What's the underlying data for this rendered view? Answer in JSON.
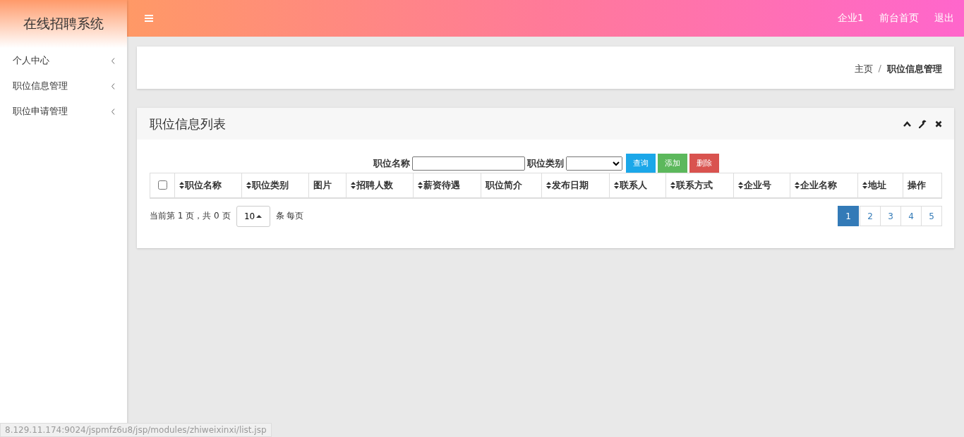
{
  "sidebar": {
    "title": "在线招聘系统",
    "items": [
      {
        "label": "个人中心",
        "expanded": false
      },
      {
        "label": "职位信息管理",
        "expanded": false
      },
      {
        "label": "职位申请管理",
        "expanded": false
      }
    ]
  },
  "topbar": {
    "links": [
      "企业1",
      "前台首页",
      "退出"
    ]
  },
  "breadcrumb": {
    "items": [
      "主页",
      "职位信息管理"
    ],
    "separator": "/"
  },
  "panel": {
    "title": "职位信息列表",
    "search": {
      "name_label": "职位名称",
      "type_label": "职位类别",
      "buttons": [
        {
          "label": "查询",
          "kind": "query"
        },
        {
          "label": "添加",
          "kind": "add"
        },
        {
          "label": "删除",
          "kind": "delete"
        }
      ]
    },
    "table": {
      "select_all_checked": false,
      "columns": [
        {
          "label": "职位名称",
          "sortable": true
        },
        {
          "label": "职位类别",
          "sortable": true
        },
        {
          "label": "图片",
          "sortable": false
        },
        {
          "label": "招聘人数",
          "sortable": true
        },
        {
          "label": "薪资待遇",
          "sortable": true
        },
        {
          "label": "职位简介",
          "sortable": false
        },
        {
          "label": "发布日期",
          "sortable": true
        },
        {
          "label": "联系人",
          "sortable": true
        },
        {
          "label": "联系方式",
          "sortable": true
        },
        {
          "label": "企业号",
          "sortable": true
        },
        {
          "label": "企业名称",
          "sortable": true
        },
        {
          "label": "地址",
          "sortable": true
        },
        {
          "label": "操作",
          "sortable": false
        }
      ]
    },
    "pager": {
      "info": "当前第 1 页，共 0 页",
      "page_size": "10",
      "per_page_label": "条 每页",
      "pages": [
        {
          "label": "1",
          "selected": true
        },
        {
          "label": "2",
          "selected": false
        },
        {
          "label": "3",
          "selected": false
        },
        {
          "label": "4",
          "selected": false
        },
        {
          "label": "5",
          "selected": false
        }
      ]
    }
  },
  "status_bar": {
    "url": "8.129.11.174:9024/jspmfz6u8/jsp/modules/zhiweixinxi/list.jsp"
  }
}
